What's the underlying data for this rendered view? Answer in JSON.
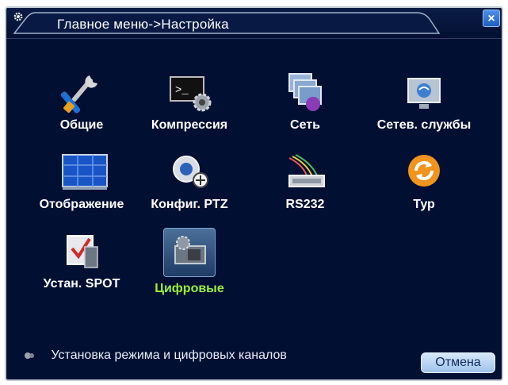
{
  "window": {
    "title": "Главное меню->Настройка",
    "close_label": "×"
  },
  "menu": {
    "items": [
      {
        "label": "Общие",
        "icon": "tools-icon"
      },
      {
        "label": "Компрессия",
        "icon": "terminal-gear-icon"
      },
      {
        "label": "Сеть",
        "icon": "network-icon"
      },
      {
        "label": "Сетев. службы",
        "icon": "monitor-globe-icon"
      },
      {
        "label": "Отображение",
        "icon": "display-grid-icon"
      },
      {
        "label": "Конфиг. PTZ",
        "icon": "ptz-camera-icon"
      },
      {
        "label": "RS232",
        "icon": "cable-connector-icon"
      },
      {
        "label": "Тур",
        "icon": "refresh-icon"
      },
      {
        "label": "Устан. SPOT",
        "icon": "spot-config-icon"
      },
      {
        "label": "Цифровые",
        "icon": "digital-camera-icon",
        "selected": true
      }
    ]
  },
  "status": {
    "hint": "Установка режима и цифровых каналов"
  },
  "footer": {
    "cancel_label": "Отмена"
  },
  "colors": {
    "background": "#010f33",
    "selected_label": "#9bf03b",
    "text": "#ffffff"
  }
}
